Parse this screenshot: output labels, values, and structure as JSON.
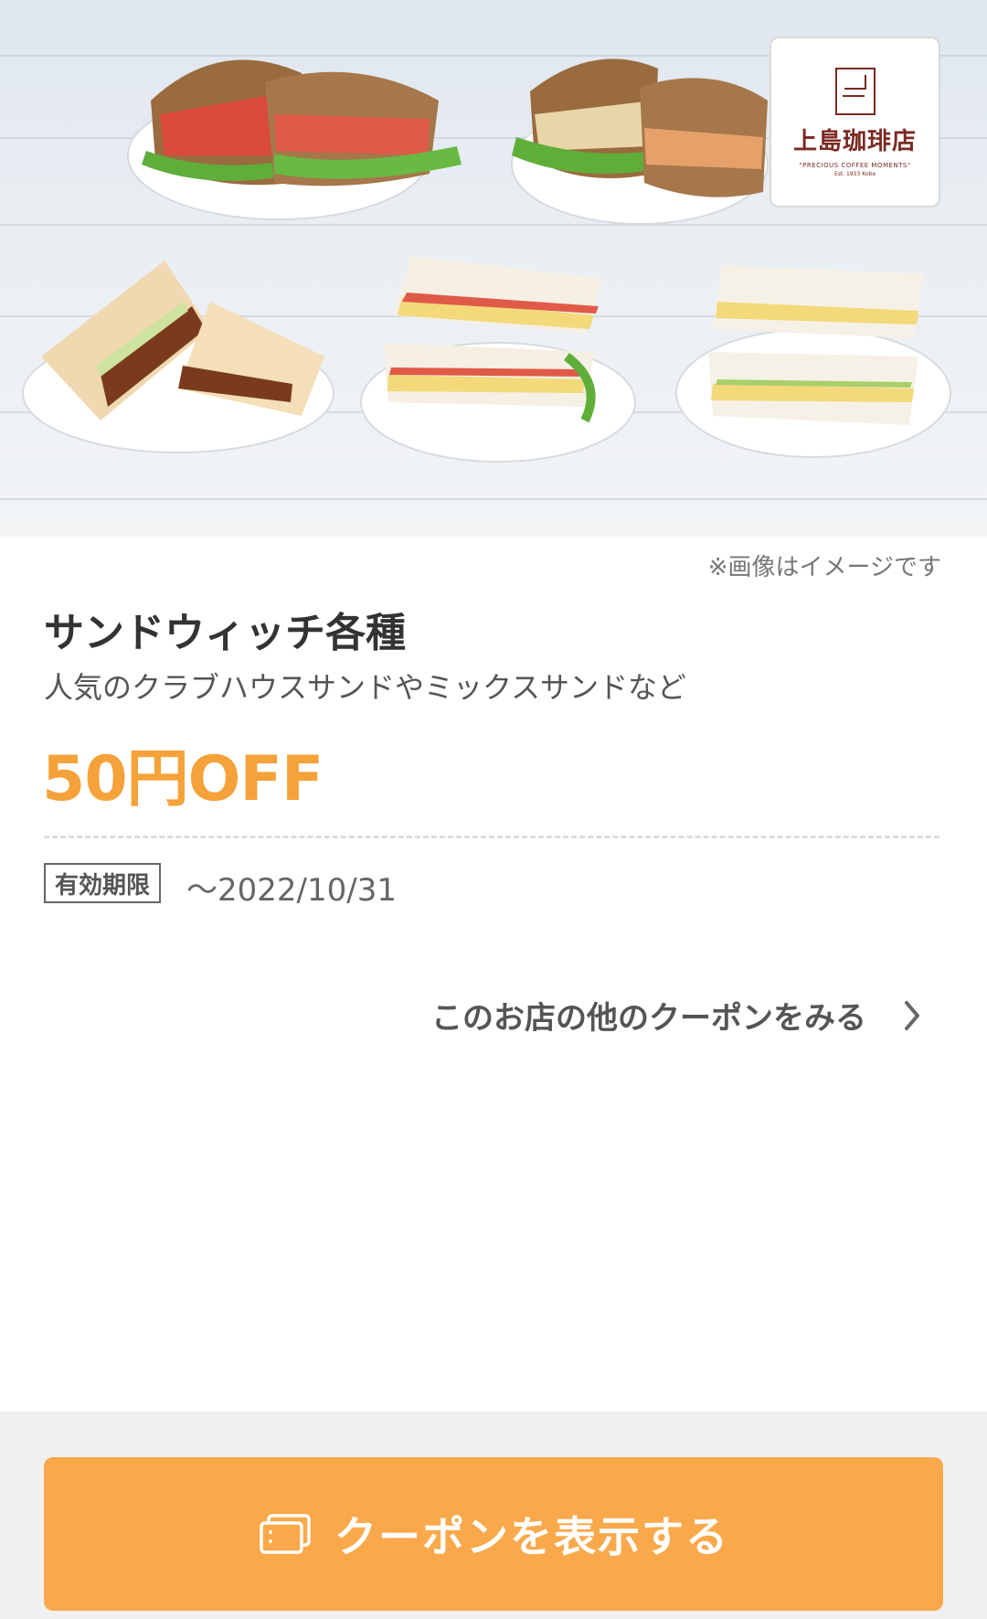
{
  "hero": {
    "image_note": "※画像はイメージです",
    "brand": {
      "name": "上島珈琲店",
      "tagline": "\"PRECIOUS COFFEE MOMENTS\"",
      "est": "Est. 1933 Kobe"
    }
  },
  "coupon": {
    "title": "サンドウィッチ各種",
    "subtitle": "人気のクラブハウスサンドやミックスサンドなど",
    "discount": "50円OFF",
    "validity_label": "有効期限",
    "validity_date": "〜2022/10/31"
  },
  "links": {
    "other_coupons": "このお店の他のクーポンをみる"
  },
  "footer": {
    "cta_label": "クーポンを表示する"
  },
  "colors": {
    "accent": "#f9a94b",
    "discount": "#f5a23a",
    "brand": "#7a2a22"
  },
  "icons": {
    "chevron": "chevron-right-icon",
    "coupon": "coupon-icon"
  }
}
